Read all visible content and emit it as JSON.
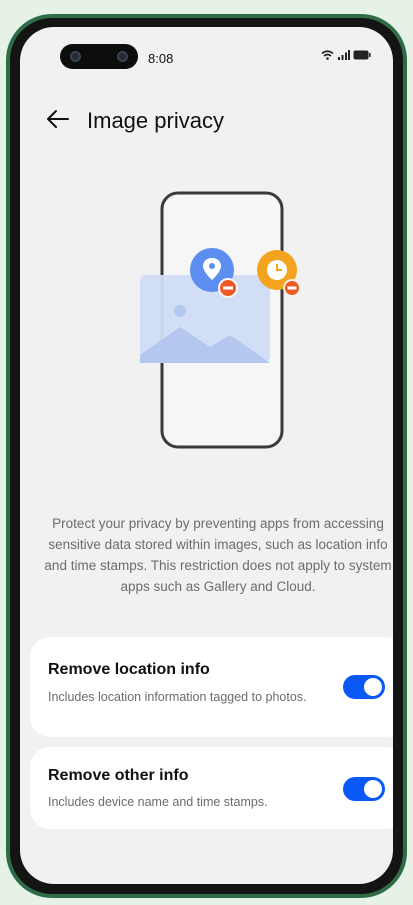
{
  "status_bar": {
    "time": "8:08",
    "icons": [
      "wifi-icon",
      "signal-icon",
      "battery-icon"
    ]
  },
  "header": {
    "back_icon": "back-arrow-icon",
    "title": "Image privacy"
  },
  "illustration": {
    "icons": [
      "phone-outline-icon",
      "image-icon",
      "location-pin-icon",
      "clock-icon",
      "remove-badge-icon"
    ],
    "colors": {
      "location_badge": "#5b8ef0",
      "clock_badge": "#f3a31e",
      "remove_badge": "#ef5a23",
      "image_fill": "#cfdcf5"
    }
  },
  "description": "Protect your privacy by preventing apps from accessing sensitive data stored within images, such as location info and time stamps. This restriction does not apply to system apps such as Gallery and Cloud.",
  "settings": [
    {
      "title": "Remove location info",
      "subtitle": "Includes location information tagged to photos.",
      "enabled": true
    },
    {
      "title": "Remove other info",
      "subtitle": "Includes device name and time stamps.",
      "enabled": true
    }
  ],
  "colors": {
    "accent": "#0a59f7",
    "frame": "#2f6b45",
    "background": "#f1f1f1"
  }
}
